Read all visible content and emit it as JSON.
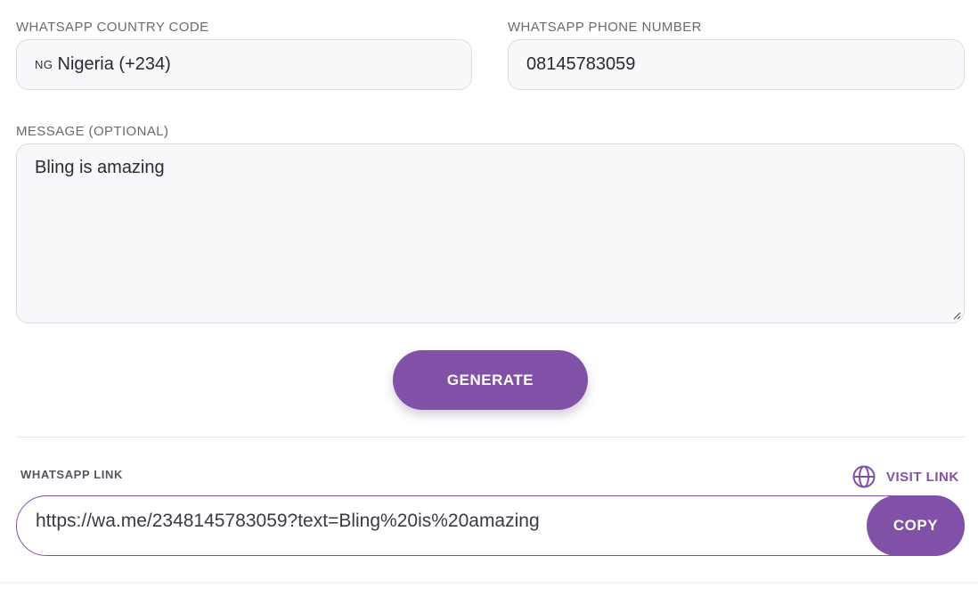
{
  "form": {
    "country_label": "WHATSAPP COUNTRY CODE",
    "country_flag": "NG",
    "country_value": "Nigeria (+234)",
    "phone_label": "WHATSAPP PHONE NUMBER",
    "phone_value": "08145783059",
    "message_label": "MESSAGE (OPTIONAL)",
    "message_value": "Bling is amazing",
    "generate_label": "GENERATE"
  },
  "result": {
    "link_label": "WHATSAPP LINK",
    "visit_label": "VISIT LINK",
    "visit_icon": "globe-icon",
    "link_value": "https://wa.me/2348145783059?text=Bling%20is%20amazing",
    "copy_label": "COPY"
  },
  "colors": {
    "accent": "#8151a8",
    "input_background": "#f8f8fb",
    "input_border": "#dcdce4",
    "label_text": "#6b6b6b"
  }
}
